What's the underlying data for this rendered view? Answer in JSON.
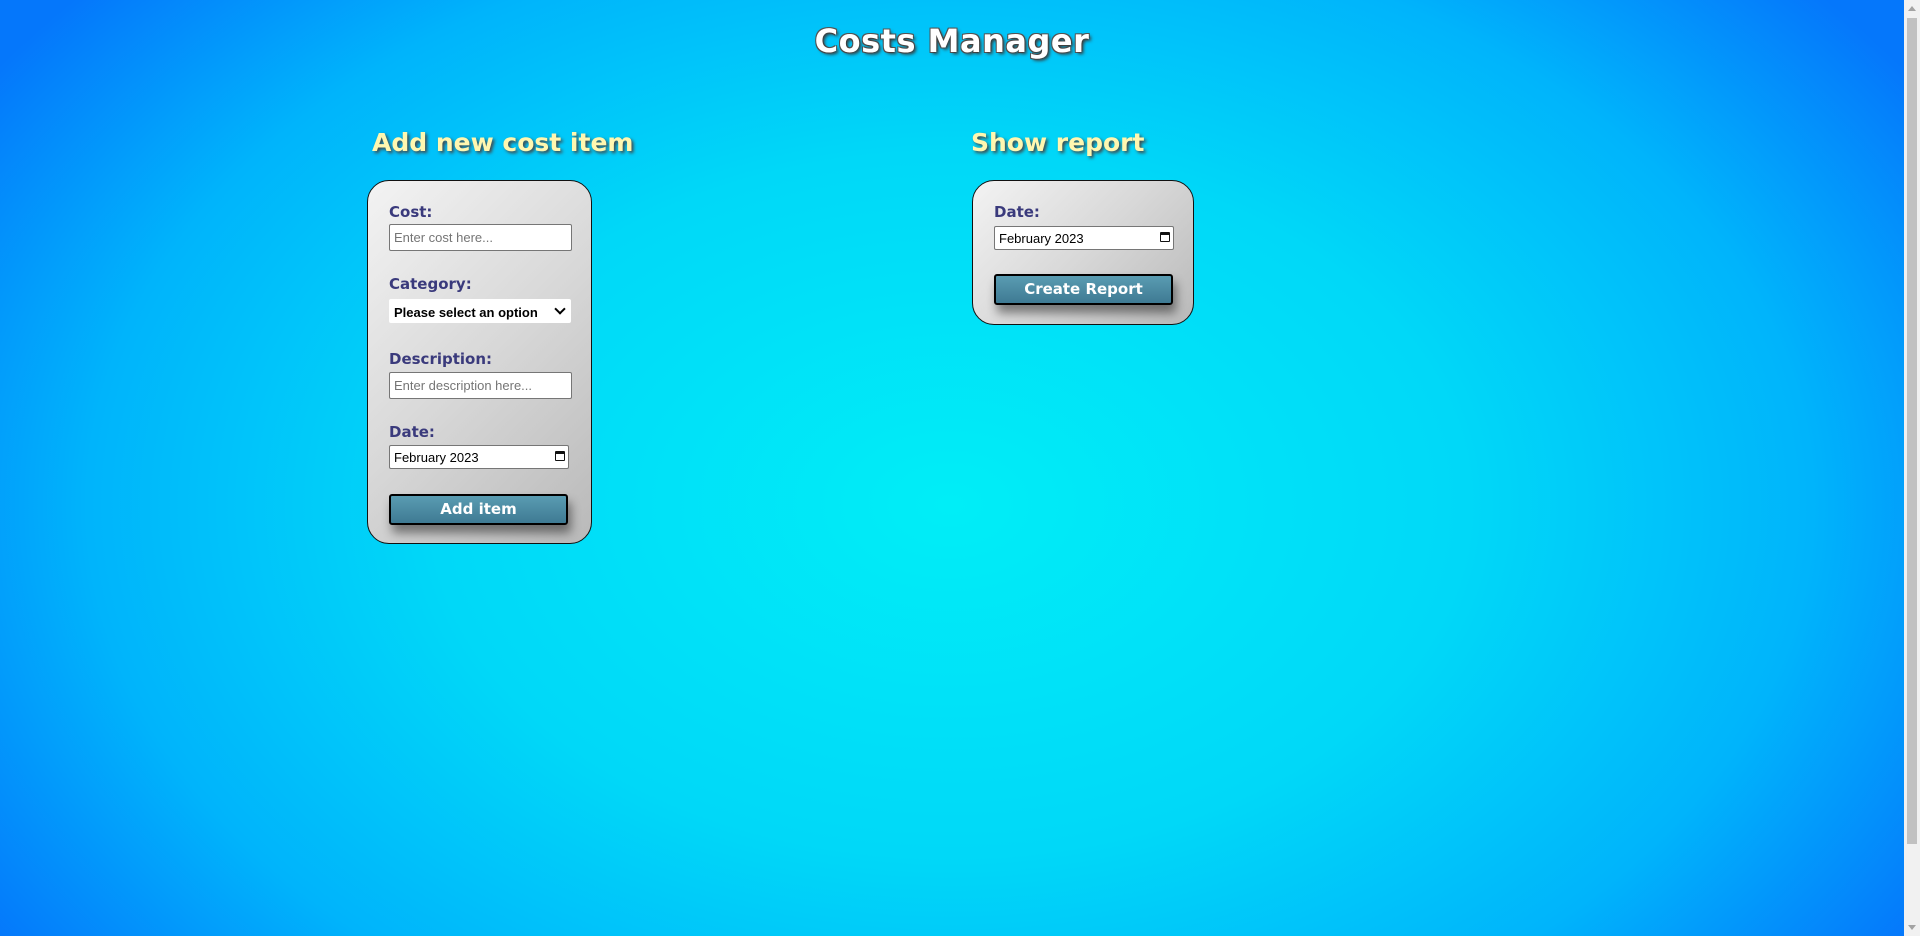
{
  "app": {
    "title": "Costs Manager"
  },
  "add_form": {
    "heading": "Add new cost item",
    "cost_label": "Cost:",
    "cost_placeholder": "Enter cost here...",
    "category_label": "Category:",
    "category_selected": "Please select an option",
    "description_label": "Description:",
    "description_placeholder": "Enter description here...",
    "date_label": "Date:",
    "date_value": "February 2023",
    "submit_label": "Add item"
  },
  "report_form": {
    "heading": "Show report",
    "date_label": "Date:",
    "date_value": "February 2023",
    "submit_label": "Create Report"
  },
  "icons": {
    "calendar": "calendar-icon",
    "dropdown": "chevron-down-icon"
  },
  "colors": {
    "background_center": "#00eef7",
    "background_edge": "#0577fb",
    "heading": "#fff7b0",
    "label": "#3a3a7c",
    "button": "#4a8aa3"
  }
}
